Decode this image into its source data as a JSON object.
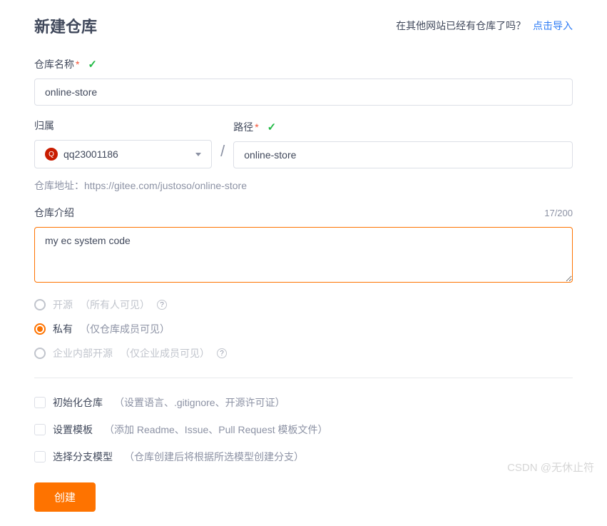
{
  "header": {
    "title": "新建仓库",
    "import_hint": "在其他网站已经有仓库了吗？",
    "import_link": "点击导入"
  },
  "form": {
    "name": {
      "label": "仓库名称",
      "value": "online-store"
    },
    "owner": {
      "label": "归属",
      "selected": "qq23001186",
      "avatar_letter": "Q"
    },
    "path": {
      "label": "路径",
      "value": "online-store"
    },
    "url_hint_label": "仓库地址：",
    "url_hint_value": "https://gitee.com/justoso/online-store",
    "intro": {
      "label": "仓库介绍",
      "value": "my ec system code",
      "char_count": "17/200"
    },
    "visibility": {
      "options": [
        {
          "main": "开源",
          "sub": "（所有人可见）",
          "selected": false,
          "disabled": true,
          "help": true
        },
        {
          "main": "私有",
          "sub": "（仅仓库成员可见）",
          "selected": true,
          "disabled": false,
          "help": false
        },
        {
          "main": "企业内部开源",
          "sub": "（仅企业成员可见）",
          "selected": false,
          "disabled": true,
          "help": true
        }
      ]
    },
    "checkboxes": [
      {
        "main": "初始化仓库",
        "sub": "（设置语言、.gitignore、开源许可证）"
      },
      {
        "main": "设置模板",
        "sub": "（添加 Readme、Issue、Pull Request 模板文件）"
      },
      {
        "main": "选择分支模型",
        "sub": "（仓库创建后将根据所选模型创建分支）"
      }
    ],
    "submit_label": "创建"
  },
  "watermark": "CSDN @无休止符"
}
